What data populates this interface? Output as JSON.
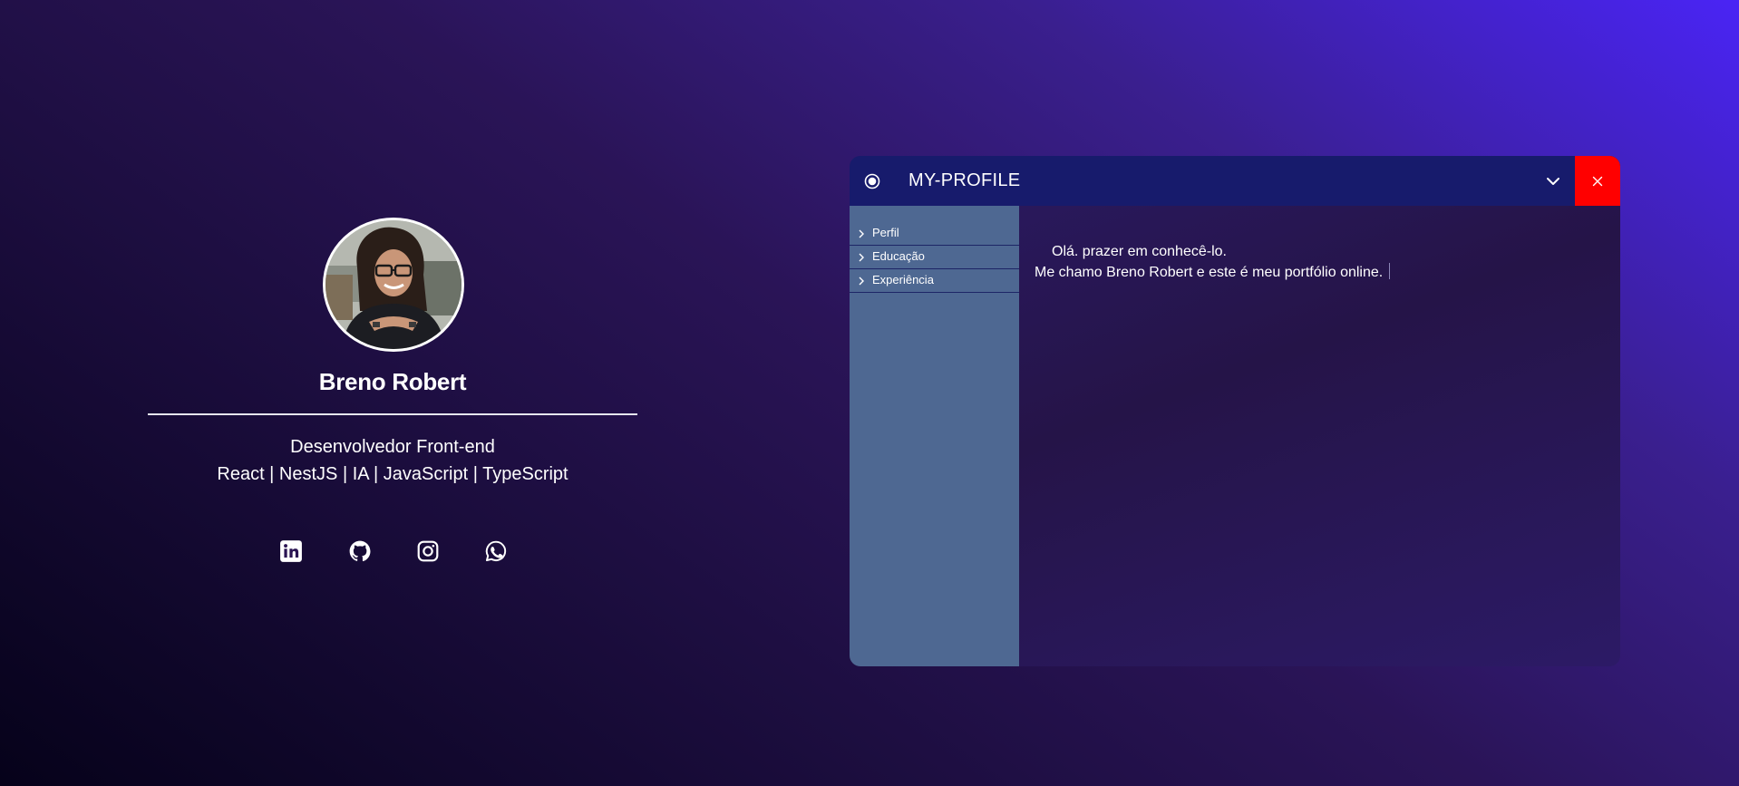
{
  "profile": {
    "name": "Breno Robert",
    "role": "Desenvolvedor Front-end",
    "stack": "React | NestJS | IA | JavaScript | TypeScript",
    "socials": [
      {
        "icon": "linkedin-icon"
      },
      {
        "icon": "github-icon"
      },
      {
        "icon": "instagram-icon"
      },
      {
        "icon": "whatsapp-icon"
      }
    ]
  },
  "window": {
    "title": "MY-PROFILE",
    "close_color": "#ff0000",
    "sidebar": {
      "items": [
        {
          "label": "Perfil"
        },
        {
          "label": "Educação"
        },
        {
          "label": "Experiência"
        }
      ]
    },
    "content": {
      "greeting": "Olá. prazer em conhecê-lo.",
      "intro": "Me chamo Breno Robert e este é meu portfólio online."
    }
  },
  "colors": {
    "titlebar": "#171b6c",
    "sidebar": "#4e6892",
    "accent": "#4a24f5"
  }
}
